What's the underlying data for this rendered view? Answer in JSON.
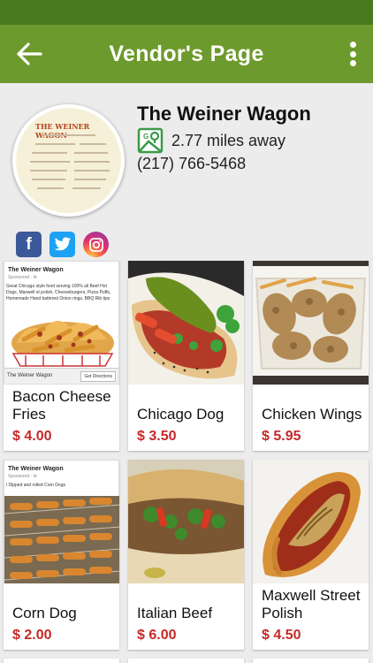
{
  "appbar": {
    "title": "Vendor's Page"
  },
  "vendor": {
    "name": "The Weiner Wagon",
    "distance": "2.77 miles away",
    "phone": "(217) 766-5468",
    "logo_text": "THE WEINER WAGON"
  },
  "social": {
    "facebook": "f",
    "twitter": "t",
    "instagram": "instagram"
  },
  "items": [
    {
      "name": "Bacon Cheese Fries",
      "price": "$ 4.00",
      "ad": {
        "header": "The Weiner Wagon",
        "sponsored": "Sponsored · ⚙",
        "text": "Great Chicago style food serving 100% all Beef Hot Dogs, Maxwell st polish, Cheeseburgers, Pizza Puffs, Homemade Hand battered Onion rings, BBQ Rib tips",
        "footer": "The Weiner Wagon",
        "button": "Get Directions"
      }
    },
    {
      "name": "Chicago Dog",
      "price": "$ 3.50"
    },
    {
      "name": "Chicken Wings",
      "price": "$ 5.95"
    },
    {
      "name": "Corn Dog",
      "price": "$ 2.00",
      "ad": {
        "header": "The Weiner Wagon",
        "sponsored": "Sponsored · ⚙",
        "text": "l Dipped and rolled Corn Dogs"
      }
    },
    {
      "name": "Italian Beef",
      "price": "$ 6.00"
    },
    {
      "name": "Maxwell Street Polish",
      "price": "$ 4.50"
    }
  ],
  "colors": {
    "appbar": "#6d9a2c",
    "statusbar": "#4a7a1f",
    "price": "#c62828"
  }
}
